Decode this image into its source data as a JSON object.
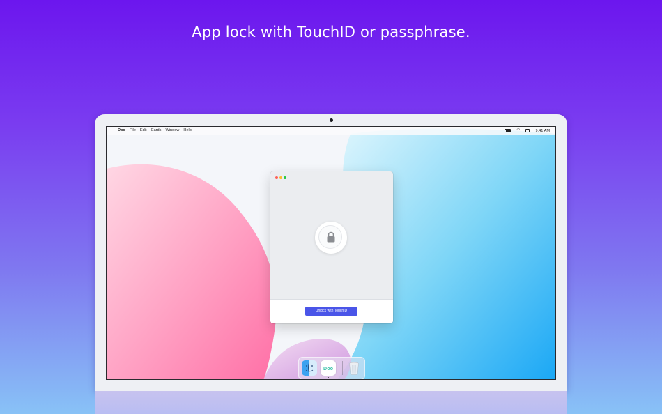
{
  "headline": "App lock with TouchID or passphrase.",
  "menubar": {
    "app_name": "Doo",
    "items": [
      "File",
      "Edit",
      "Cards",
      "Window",
      "Help"
    ],
    "time": "9:41 AM"
  },
  "window": {
    "unlock_button_label": "Unlock with TouchID"
  },
  "dock": {
    "apps": [
      "finder-icon",
      "doo-app-icon",
      "trash-icon"
    ],
    "doo_icon_text": "Doo"
  },
  "colors": {
    "accent": "#4a55e8",
    "background_top": "#6c16ee",
    "background_bottom": "#88c2f6"
  }
}
